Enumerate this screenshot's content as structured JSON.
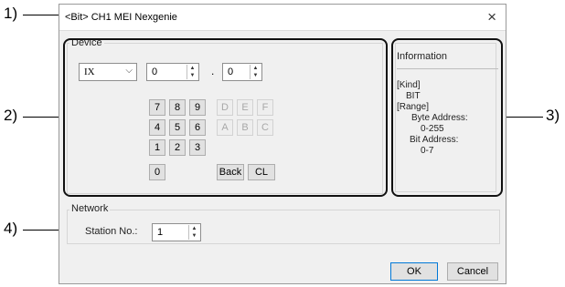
{
  "callouts": [
    "1)",
    "2)",
    "3)",
    "4)"
  ],
  "dialog": {
    "title": "<Bit> CH1 MEI Nexgenie",
    "close_glyph": "×"
  },
  "device": {
    "group_label": "Device",
    "device_type": "IX",
    "byte_value": "0",
    "separator": ".",
    "bit_value": "0",
    "keys": [
      "7",
      "8",
      "9",
      "D",
      "E",
      "F",
      "4",
      "5",
      "6",
      "A",
      "B",
      "C",
      "1",
      "2",
      "3",
      "0"
    ],
    "back_label": "Back",
    "clear_label": "CL"
  },
  "information": {
    "title": "Information",
    "kind_label": "[Kind]",
    "kind_value": "BIT",
    "range_label": "[Range]",
    "byte_label": "Byte Address:",
    "byte_range": "0-255",
    "bit_label": "Bit Address:",
    "bit_range": "0-7"
  },
  "network": {
    "group_label": "Network",
    "station_label": "Station No.:",
    "station_value": "1"
  },
  "buttons": {
    "ok": "OK",
    "cancel": "Cancel"
  },
  "icons": {
    "dropdown": "chevron-down-icon",
    "spin": "spin-arrows-icon",
    "close": "close-icon"
  }
}
